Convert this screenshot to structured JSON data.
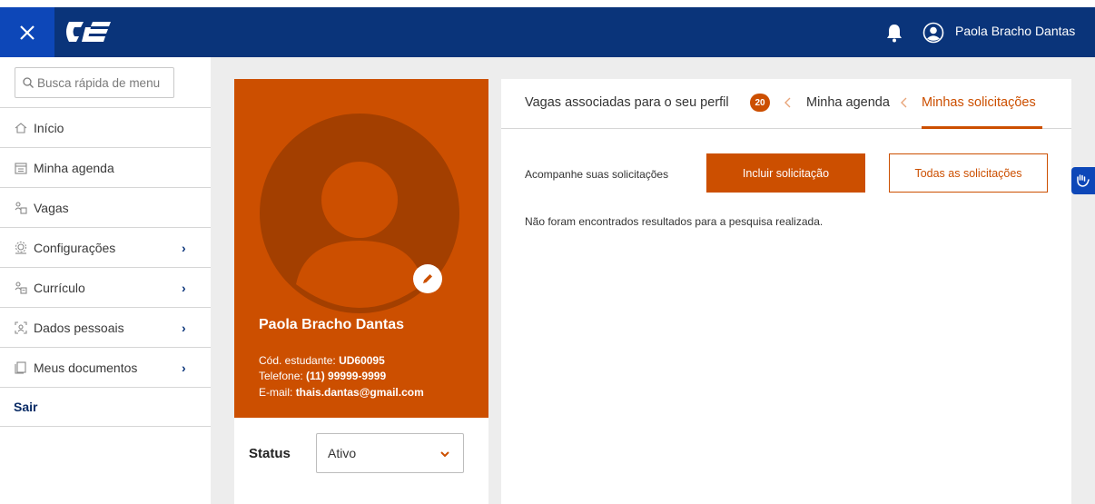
{
  "header": {
    "logo_text": "CIEE",
    "user_name": "Paola Bracho Dantas",
    "close_icon": "close-icon",
    "bell_icon": "bell-icon",
    "user_icon": "user-circle-icon"
  },
  "sidebar": {
    "search_placeholder": "Busca rápida de menu",
    "items": [
      {
        "label": "Início",
        "icon": "home-icon"
      },
      {
        "label": "Minha agenda",
        "icon": "calendar-icon"
      },
      {
        "label": "Vagas",
        "icon": "vagas-icon"
      },
      {
        "label": "Configurações",
        "icon": "settings-icon",
        "chevron": "›"
      },
      {
        "label": "Currículo",
        "icon": "resume-icon",
        "chevron": "›"
      },
      {
        "label": "Dados pessoais",
        "icon": "personal-data-icon",
        "chevron": "›"
      },
      {
        "label": "Meus documentos",
        "icon": "documents-icon",
        "chevron": "›"
      },
      {
        "label": "Sair"
      }
    ]
  },
  "profile": {
    "name": "Paola Bracho Dantas",
    "code_label": "Cód. estudante:",
    "code_value": "UD60095",
    "phone_label": "Telefone:",
    "phone_value": "(11) 99999-9999",
    "email_label": "E-mail:",
    "email_value": "thais.dantas@gmail.com",
    "status_label": "Status",
    "status_value": "Ativo"
  },
  "tabs": {
    "vagas_label": "Vagas associadas para o seu perfil",
    "vagas_badge": "20",
    "agenda_label": "Minha agenda",
    "solicitacoes_label": "Minhas solicitações"
  },
  "content": {
    "acompanhe": "Acompanhe suas solicitações",
    "incluir_button": "Incluir solicitação",
    "todas_button": "Todas as solicitações",
    "no_results": "Não foram encontrados resultados para a pesquisa realizada."
  },
  "colors": {
    "header_bg": "#0a347a",
    "accent": "#cc4f00",
    "sidebar_accent": "#0d47b8"
  }
}
